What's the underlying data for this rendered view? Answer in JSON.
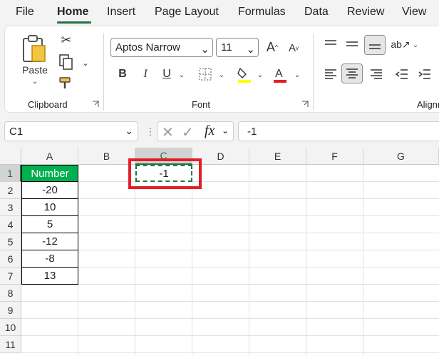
{
  "menu": {
    "tabs": [
      {
        "label": "File",
        "active": false
      },
      {
        "label": "Home",
        "active": true
      },
      {
        "label": "Insert",
        "active": false
      },
      {
        "label": "Page Layout",
        "active": false
      },
      {
        "label": "Formulas",
        "active": false
      },
      {
        "label": "Data",
        "active": false
      },
      {
        "label": "Review",
        "active": false
      },
      {
        "label": "View",
        "active": false
      }
    ]
  },
  "ribbon": {
    "clipboard": {
      "paste_label": "Paste",
      "group_label": "Clipboard"
    },
    "font": {
      "font_name": "Aptos Narrow",
      "font_size": "11",
      "group_label": "Font",
      "highlight_color": "#ffff00",
      "font_color": "#e21f26"
    },
    "alignment": {
      "group_label": "Alignm"
    }
  },
  "formula_bar": {
    "name_box": "C1",
    "fx_label": "fx",
    "formula": "-1"
  },
  "sheet": {
    "columns": [
      "A",
      "B",
      "C",
      "D",
      "E",
      "F",
      "G"
    ],
    "selected_column": "C",
    "rows": [
      "1",
      "2",
      "3",
      "4",
      "5",
      "6",
      "7",
      "8",
      "9",
      "10",
      "11"
    ],
    "selected_row": "1",
    "column_a": {
      "header": "Number",
      "values": [
        "-20",
        "10",
        "5",
        "-12",
        "-8",
        "13"
      ]
    },
    "active_cell_value": "-1",
    "header_fill": "#00b050",
    "highlight_color": "#e21f26"
  }
}
